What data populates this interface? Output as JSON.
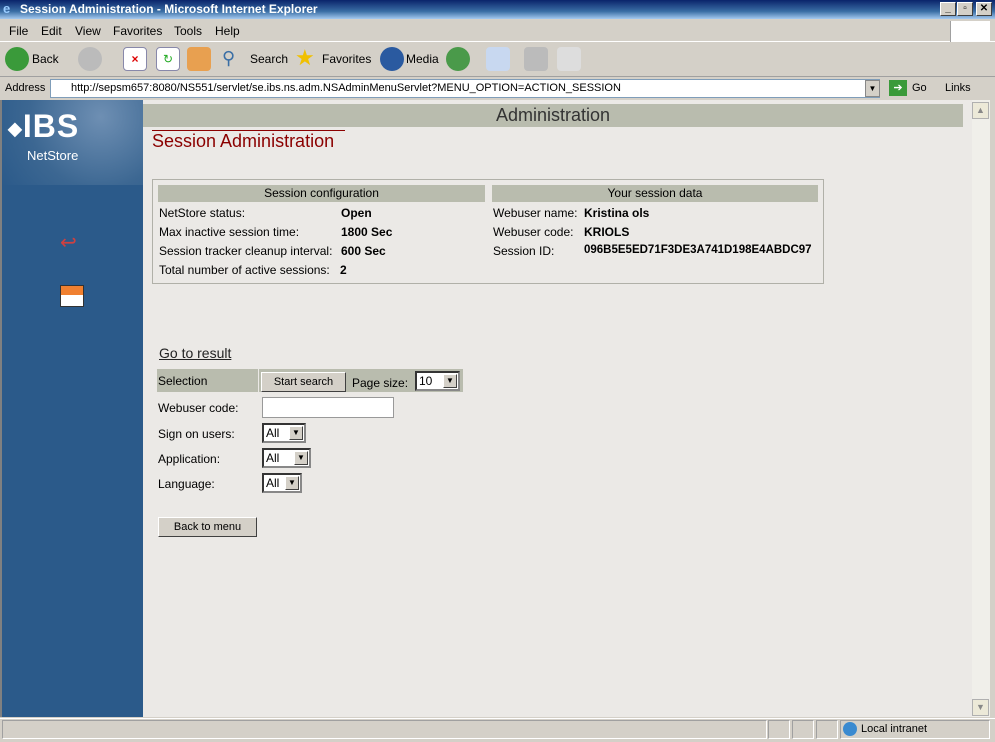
{
  "window": {
    "title": "Session Administration - Microsoft Internet Explorer"
  },
  "menu": [
    "File",
    "Edit",
    "View",
    "Favorites",
    "Tools",
    "Help"
  ],
  "toolbar": {
    "back": "Back",
    "search": "Search",
    "favorites": "Favorites",
    "media": "Media"
  },
  "address": {
    "label": "Address",
    "url": "http://sepsm657:8080/NS551/servlet/se.ibs.ns.adm.NSAdminMenuServlet?MENU_OPTION=ACTION_SESSION",
    "go": "Go",
    "links": "Links"
  },
  "sidebar": {
    "logo": "IBS",
    "product": "NetStore"
  },
  "page": {
    "header": "Administration",
    "title": "Session Administration"
  },
  "config": {
    "heading": "Session configuration",
    "rows": [
      {
        "label": "NetStore status:",
        "value": "Open"
      },
      {
        "label": "Max inactive session time:",
        "value": "1800 Sec"
      },
      {
        "label": "Session tracker cleanup interval:",
        "value": "600 Sec"
      },
      {
        "label": "Total number of active sessions:",
        "value": "2"
      }
    ]
  },
  "session": {
    "heading": "Your session data",
    "rows": [
      {
        "label": "Webuser name:",
        "value": "Kristina ols"
      },
      {
        "label": "Webuser code:",
        "value": "KRIOLS"
      },
      {
        "label": "Session ID:",
        "value": "096B5E5ED71F3DE3A741D198E4ABDC97"
      }
    ]
  },
  "search": {
    "go_to_result": "Go to result",
    "selection": "Selection",
    "start_search": "Start search",
    "page_size_label": "Page size:",
    "page_size": "10",
    "webuser_code_label": "Webuser code:",
    "webuser_code": "",
    "sign_on_label": "Sign on users:",
    "sign_on": "All",
    "application_label": "Application:",
    "application": "All",
    "language_label": "Language:",
    "language": "All",
    "back": "Back to menu"
  },
  "status": {
    "zone": "Local intranet"
  }
}
